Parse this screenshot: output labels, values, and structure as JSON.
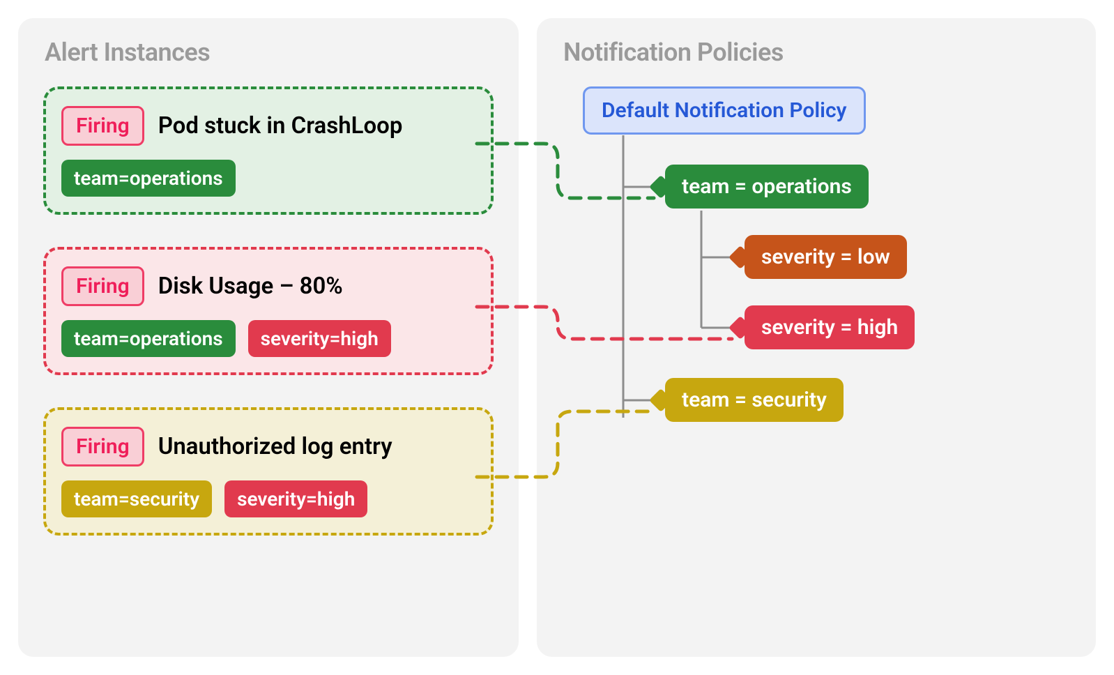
{
  "left": {
    "title": "Alert Instances",
    "firing_label": "Firing",
    "alerts": [
      {
        "color": "green",
        "title": "Pod stuck in CrashLoop",
        "tags": [
          {
            "text": "team=operations",
            "color": "green"
          }
        ]
      },
      {
        "color": "red",
        "title": "Disk Usage – 80%",
        "tags": [
          {
            "text": "team=operations",
            "color": "green"
          },
          {
            "text": "severity=high",
            "color": "red"
          }
        ]
      },
      {
        "color": "yellow",
        "title": "Unauthorized log entry",
        "tags": [
          {
            "text": "team=security",
            "color": "yellow"
          },
          {
            "text": "severity=high",
            "color": "red"
          }
        ]
      }
    ]
  },
  "right": {
    "title": "Notification Policies",
    "default_label": "Default Notification Policy",
    "nodes": {
      "team_operations": "team = operations",
      "severity_low": "severity = low",
      "severity_high": "severity = high",
      "team_security": "team = security"
    }
  },
  "colors": {
    "green": "#2a8c3c",
    "red": "#e13a4e",
    "yellow": "#c7a70f",
    "orange": "#c6541a",
    "blue": "#2558d6"
  }
}
